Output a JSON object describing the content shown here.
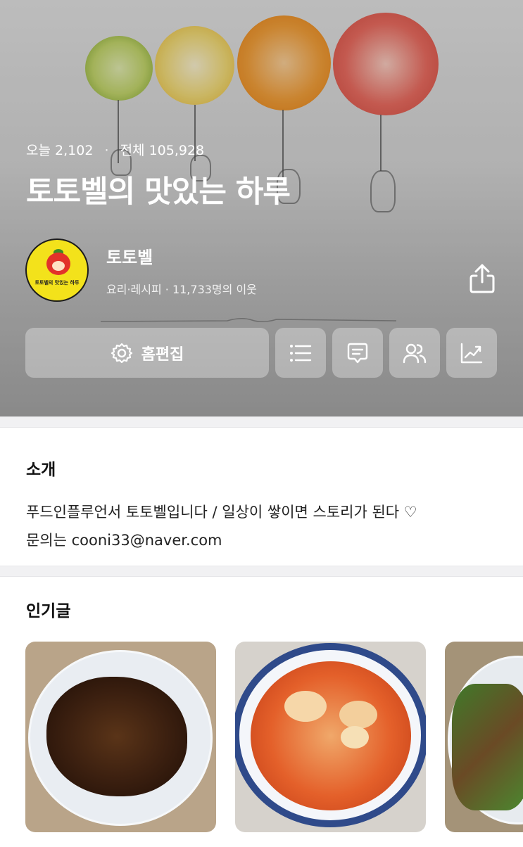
{
  "cover": {
    "stats": {
      "today_label": "오늘",
      "today_count": "2,102",
      "separator": "·",
      "total_label": "전체",
      "total_count": "105,928"
    },
    "blog_title": "토토벨의 맛있는 하루",
    "avatar_caption": "토토벨의 맛있는 하루",
    "nickname": "토토벨",
    "meta": "요리·레시피 · 11,733명의 이웃",
    "buttons": {
      "edit_label": "홈편집",
      "edit_icon": "gear-icon",
      "list_icon": "list-icon",
      "comment_icon": "message-icon",
      "neighbors_icon": "people-icon",
      "stats_icon": "chart-icon",
      "share_icon": "share-icon"
    }
  },
  "intro": {
    "title": "소개",
    "line1": "푸드인플루언서 토토벨입니다 / 일상이 쌓이면 스토리가 된다 ♡",
    "line2": "문의는 cooni33@naver.com"
  },
  "popular": {
    "title": "인기글",
    "cards": [
      {
        "image": "braised-food-thumbnail"
      },
      {
        "image": "spicy-stew-thumbnail"
      },
      {
        "image": "green-onion-dish-thumbnail"
      }
    ]
  },
  "colors": {
    "avatar_bg": "#f3e21b",
    "button_bg": "rgba(255,255,255,0.32)",
    "divider": "#f1f1f3"
  }
}
